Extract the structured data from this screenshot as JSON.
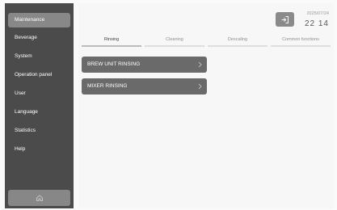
{
  "sidebar": {
    "items": [
      {
        "label": "Maintenance",
        "active": true
      },
      {
        "label": "Beverage"
      },
      {
        "label": "System"
      },
      {
        "label": "Operation panel"
      },
      {
        "label": "User"
      },
      {
        "label": "Language"
      },
      {
        "label": "Statistics"
      },
      {
        "label": "Help"
      }
    ],
    "home_icon": "home-icon"
  },
  "header": {
    "date": "2025/07/24",
    "time": "22 14",
    "logout_icon": "logout-icon"
  },
  "tabs": [
    {
      "label": "Rinsing",
      "active": true
    },
    {
      "label": "Cleaning"
    },
    {
      "label": "Descaling"
    },
    {
      "label": "Common functions"
    }
  ],
  "actions": [
    {
      "label": "BREW UNIT RINSING"
    },
    {
      "label": "MIXER RINSING"
    }
  ],
  "colors": {
    "sidebar": "#4b4b4b",
    "sidebar_active": "#888888",
    "button": "#6a6a6a",
    "background": "#f7f7f7"
  }
}
